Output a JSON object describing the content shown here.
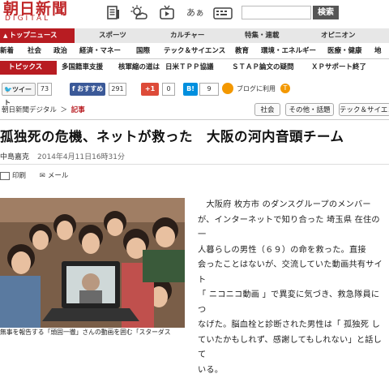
{
  "header": {
    "logo_jp": "朝日新聞",
    "logo_en": "DIGITAL",
    "icons": [
      "news-icon",
      "weather-icon",
      "tv-icon",
      "aa-icon"
    ],
    "aa_label": "あぁ",
    "search_button": "検索"
  },
  "main_nav": [
    "トップニュース",
    "スポーツ",
    "カルチャー",
    "特集・連載",
    "オピニオン"
  ],
  "sub_nav": [
    "新着",
    "社会",
    "政治",
    "経済・マネー",
    "国際",
    "テック＆サイエンス",
    "教育",
    "環境・エネルギー",
    "医療・健康",
    "地"
  ],
  "topics": {
    "label": "トピックス",
    "items": [
      "多国籍車支援",
      "核軍縮の道は",
      "日米ＴＰＰ協議",
      "ＳＴＡＰ論文の疑問",
      "ＸＰサポート終了"
    ]
  },
  "social": {
    "tweet": "ツイート",
    "tweet_count": "73",
    "like": "おすすめ",
    "like_count": "291",
    "gplus": "+1",
    "gplus_count": "0",
    "hatena": "B!",
    "hatena_count": "9",
    "blog": "ブログに利用"
  },
  "breadcrumb": {
    "site": "朝日新聞デジタル",
    "sep": "＞",
    "section": "記事"
  },
  "section_tabs": [
    "社会",
    "その他・話題",
    "テック＆サイエン"
  ],
  "article": {
    "headline": "孤独死の危機、ネットが救った　大阪の河内音頭チーム",
    "author": "中島嘉克",
    "date": "2014年4月11日16時31分",
    "print": "印刷",
    "mail": "メール",
    "caption": "無事を報告する「頭固一徹」さんの動画を囲む「スターダス",
    "body_lines": [
      "　大阪府 枚方市 のダンスグループのメンバー",
      "が、インターネットで知り合った 埼玉県 在住の一",
      "人暮らしの男性（６９）の命を救った。直接",
      "会ったことはないが、交流していた動画共有サイト",
      "「 ニコニコ動画 」で異変に気づき、救急隊員につ",
      "なげた。脳血栓と診断された男性は「 孤独死 し",
      "ていたかもしれず、感謝してもしれない」と話して",
      "いる。"
    ]
  },
  "colors": {
    "brand_red": "#b81c22",
    "twitter": "#1da1f2",
    "facebook": "#3b5998",
    "gplus": "#dd4b39",
    "hatena": "#008fde"
  }
}
